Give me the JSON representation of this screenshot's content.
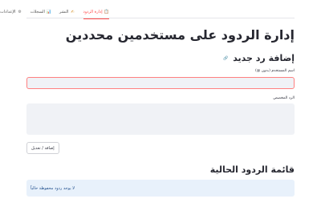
{
  "tabs": [
    {
      "label": "إدارة الردود",
      "icon": "clipboard-icon",
      "active": true
    },
    {
      "label": "النشر",
      "icon": "pen-icon",
      "active": false
    },
    {
      "label": "السجلات",
      "icon": "chart-icon",
      "active": false
    },
    {
      "label": "الإعدادات",
      "icon": "gear-icon",
      "active": false
    }
  ],
  "page": {
    "title": "إدارة الردود على مستخدمين محددين",
    "subtitle": "إضافة رد جديد",
    "subtitle_icon": "🔗",
    "username_label": "اسم المستخدم (بدون @)",
    "reply_label": "الرد المخصص",
    "username_value": "",
    "reply_value": "",
    "submit_label": "إضافة / تعديل",
    "list_title": "قائمة الردود الحالية",
    "empty_message": "لا يوجد ردود محفوظة حالياً"
  },
  "colors": {
    "accent": "#ff4b4b",
    "info_bg": "#e8f1fb",
    "input_bg": "#f0f2f6"
  }
}
